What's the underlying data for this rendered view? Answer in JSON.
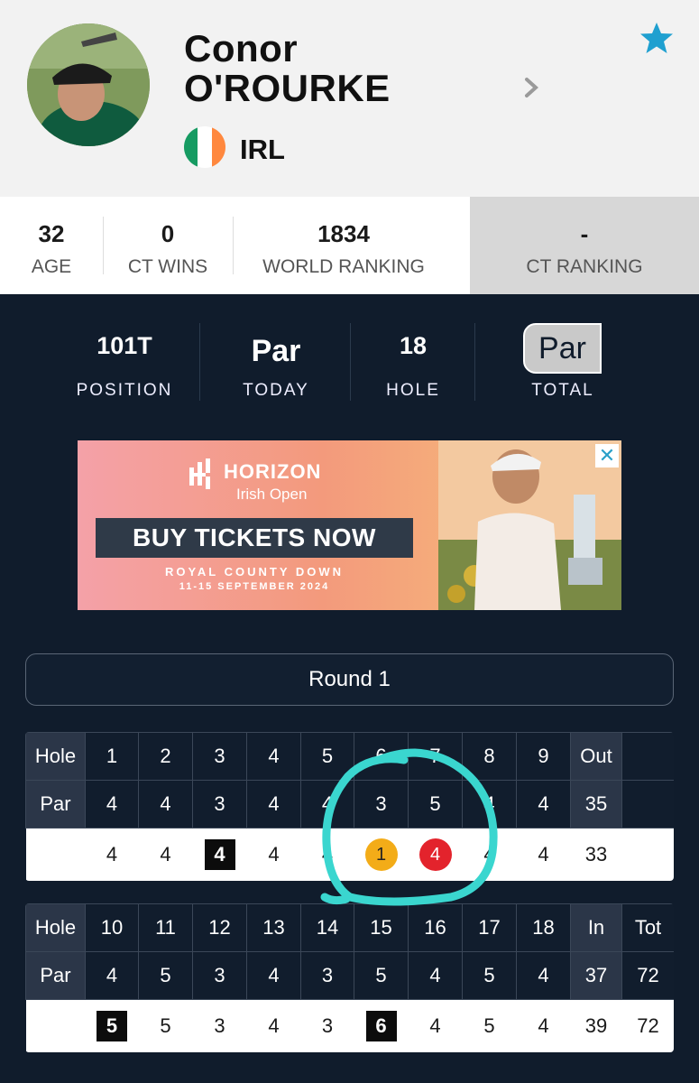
{
  "player": {
    "first_name": "Conor",
    "last_name": "O'ROURKE",
    "country": "IRL",
    "flag_colors": [
      "#169b62",
      "#ffffff",
      "#ff883e"
    ],
    "avatar_icon": "player-photo"
  },
  "stats": [
    {
      "value": "32",
      "label": "AGE"
    },
    {
      "value": "0",
      "label": "CT WINS"
    },
    {
      "value": "1834",
      "label": "WORLD RANKING"
    },
    {
      "value": "-",
      "label": "CT RANKING"
    }
  ],
  "summary": [
    {
      "value": "101T",
      "label": "POSITION"
    },
    {
      "value": "Par",
      "label": "TODAY"
    },
    {
      "value": "18",
      "label": "HOLE"
    },
    {
      "value": "Par",
      "label": "TOTAL"
    }
  ],
  "ad": {
    "brand": "HORIZON",
    "subtitle": "Irish Open",
    "cta": "BUY TICKETS NOW",
    "venue": "ROYAL COUNTY DOWN",
    "dates": "11-15 SEPTEMBER 2024",
    "close_icon": "close-icon"
  },
  "round": {
    "label": "Round 1"
  },
  "front_nine": {
    "hole_label": "Hole",
    "par_label": "Par",
    "holes": [
      "1",
      "2",
      "3",
      "4",
      "5",
      "6",
      "7",
      "8",
      "9"
    ],
    "sum_label": "Out",
    "pars": [
      "4",
      "4",
      "3",
      "4",
      "4",
      "3",
      "5",
      "4",
      "4"
    ],
    "par_total": "35",
    "scores": [
      "4",
      "4",
      "4",
      "4",
      "4",
      "1",
      "4",
      "4",
      "4"
    ],
    "score_total": "33"
  },
  "back_nine": {
    "hole_label": "Hole",
    "par_label": "Par",
    "holes": [
      "10",
      "11",
      "12",
      "13",
      "14",
      "15",
      "16",
      "17",
      "18"
    ],
    "sum_label": "In",
    "tot_label": "Tot",
    "pars": [
      "4",
      "5",
      "3",
      "4",
      "3",
      "5",
      "4",
      "5",
      "4"
    ],
    "par_total": "37",
    "par_grand_total": "72",
    "scores": [
      "5",
      "5",
      "3",
      "4",
      "3",
      "6",
      "4",
      "5",
      "4"
    ],
    "score_total": "39",
    "score_grand_total": "72"
  },
  "colors": {
    "dark_bg": "#101c2c",
    "star": "#1fa0d0",
    "bogey": "#0c0c0c",
    "eagle": "#f3ac18",
    "birdie": "#e3232c",
    "annotation": "#3ad6cf"
  }
}
